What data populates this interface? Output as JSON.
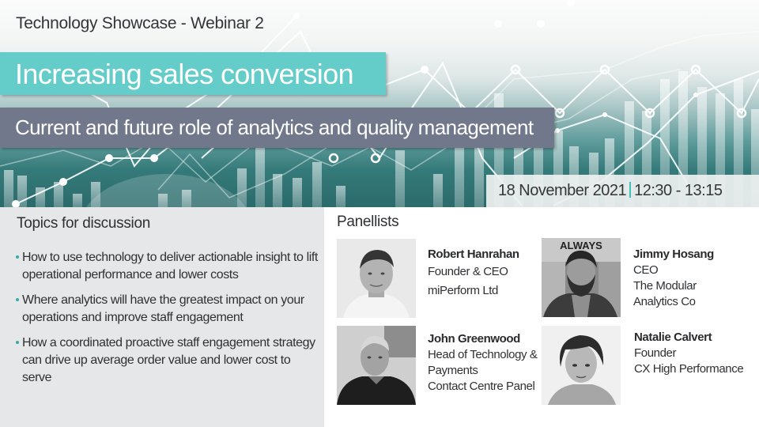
{
  "header": {
    "event_series": "Technology Showcase - Webinar 2",
    "title": "Increasing sales conversion",
    "subtitle": "Current and future role of analytics and quality management",
    "date": "18 November 2021",
    "time": "12:30 - 13:15"
  },
  "colors": {
    "title_bar": "#64ccc9",
    "subtitle_bar": "#72788b",
    "accent_separator": "#3fc0bd",
    "topics_panel": "#e6e7e8"
  },
  "topics": {
    "heading": "Topics for discussion",
    "items": [
      "How to use technology to deliver actionable insight to lift operational performance and lower costs",
      "Where analytics will have the greatest impact on your operations and improve staff engagement",
      "How a coordinated proactive staff engagement strategy can drive up average order value and lower cost to serve"
    ]
  },
  "panellists": {
    "heading": "Panellists",
    "people": [
      {
        "name": "Robert Hanrahan",
        "lines": [
          "Founder & CEO",
          "miPerform Ltd"
        ]
      },
      {
        "name": "Jimmy Hosang",
        "lines": [
          "CEO",
          "The Modular",
          "Analytics Co"
        ]
      },
      {
        "name": "John Greenwood",
        "lines": [
          "Head of Technology &",
          "Payments",
          "Contact Centre Panel"
        ]
      },
      {
        "name": "Natalie Calvert",
        "lines": [
          "Founder",
          "CX High Performance"
        ]
      }
    ]
  }
}
